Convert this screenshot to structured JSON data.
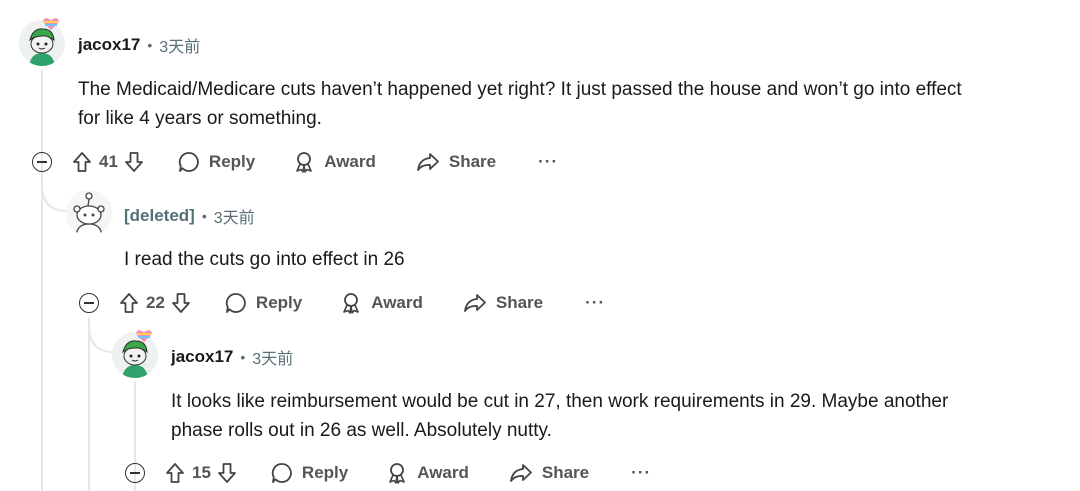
{
  "comments": [
    {
      "username": "jacox17",
      "time": "3天前",
      "avatar": "snoo-avatar-green",
      "body_lines": [
        "The Medicaid/Medicare cuts haven’t happened yet right? It just passed the house and won’t go into effect",
        "for like 4 years or something."
      ],
      "votes": "41",
      "reply_label": "Reply",
      "award_label": "Award",
      "share_label": "Share",
      "more_label": "···"
    },
    {
      "username": "[deleted]",
      "time": "3天前",
      "avatar": "deleted-snoo-avatar",
      "body_lines": [
        "I read the cuts go into effect in 26"
      ],
      "votes": "22",
      "reply_label": "Reply",
      "award_label": "Award",
      "share_label": "Share",
      "more_label": "···"
    },
    {
      "username": "jacox17",
      "time": "3天前",
      "avatar": "snoo-avatar-green",
      "body_lines": [
        "It looks like reimbursement would be cut in 27, then work requirements in 29. Maybe another",
        "phase rolls out in 26 as well. Absolutely nutty."
      ],
      "votes": "15",
      "reply_label": "Reply",
      "award_label": "Award",
      "share_label": "Share",
      "more_label": "···"
    }
  ],
  "separator": "•",
  "colors": {
    "text": "#1a1a1b",
    "muted": "#576f76",
    "action": "#555555",
    "thread_line": "#e5e8ea"
  }
}
